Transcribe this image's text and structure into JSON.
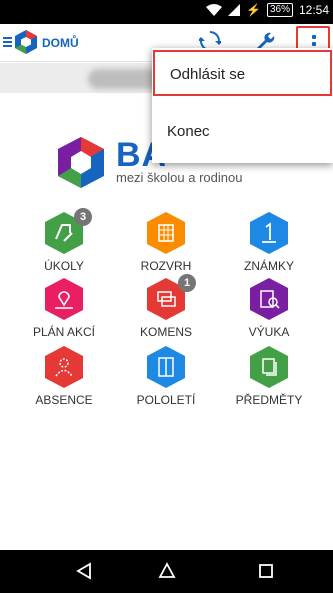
{
  "status_bar": {
    "battery_percent": "36%",
    "time": "12:54"
  },
  "app_bar": {
    "title": "DOMŮ",
    "icons": [
      "refresh-icon",
      "wrench-icon",
      "more-vert-icon"
    ],
    "accent_color": "#1565c0",
    "highlight_color": "#e53935"
  },
  "overflow_menu": {
    "items": [
      "Odhlásit se",
      "Konec"
    ]
  },
  "brand": {
    "name": "BA",
    "tagline": "mezi školou a rodinou"
  },
  "tiles": [
    {
      "label": "ÚKOLY",
      "color": "#43a047",
      "icon": "homework-icon",
      "badge": "3"
    },
    {
      "label": "ROZVRH",
      "color": "#fb8c00",
      "icon": "timetable-icon",
      "badge": ""
    },
    {
      "label": "ZNÁMKY",
      "color": "#1e88e5",
      "icon": "grades-icon",
      "badge": ""
    },
    {
      "label": "PLÁN AKCÍ",
      "color": "#e91e63",
      "icon": "events-map-icon",
      "badge": ""
    },
    {
      "label": "KOMENS",
      "color": "#e53935",
      "icon": "messages-icon",
      "badge": "1"
    },
    {
      "label": "VÝUKA",
      "color": "#7b1fa2",
      "icon": "teaching-icon",
      "badge": ""
    },
    {
      "label": "ABSENCE",
      "color": "#e53935",
      "icon": "absence-icon",
      "badge": ""
    },
    {
      "label": "POLOLETÍ",
      "color": "#1e88e5",
      "icon": "semester-book-icon",
      "badge": ""
    },
    {
      "label": "PŘEDMĚTY",
      "color": "#43a047",
      "icon": "subjects-icon",
      "badge": ""
    }
  ],
  "nav_bar": {
    "buttons": [
      "back-icon",
      "home-icon",
      "recents-icon"
    ]
  }
}
